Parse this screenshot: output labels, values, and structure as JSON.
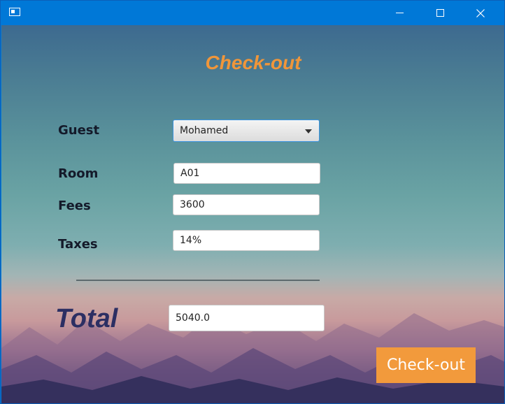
{
  "window": {
    "icon": "app-window-icon",
    "controls": {
      "minimize": "minimize-icon",
      "maximize": "maximize-icon",
      "close": "close-icon"
    }
  },
  "form": {
    "title": "Check-out",
    "guest": {
      "label": "Guest",
      "value": "Mohamed"
    },
    "room": {
      "label": "Room",
      "value": "A01"
    },
    "fees": {
      "label": "Fees",
      "value": "3600"
    },
    "taxes": {
      "label": "Taxes",
      "value": "14%"
    },
    "total": {
      "label": "Total",
      "value": "5040.0"
    },
    "checkout_button": "Check-out"
  },
  "colors": {
    "titlebar": "#0078d7",
    "title": "#f0963a",
    "button": "#f29a3c",
    "total_label": "#2c2f63"
  }
}
